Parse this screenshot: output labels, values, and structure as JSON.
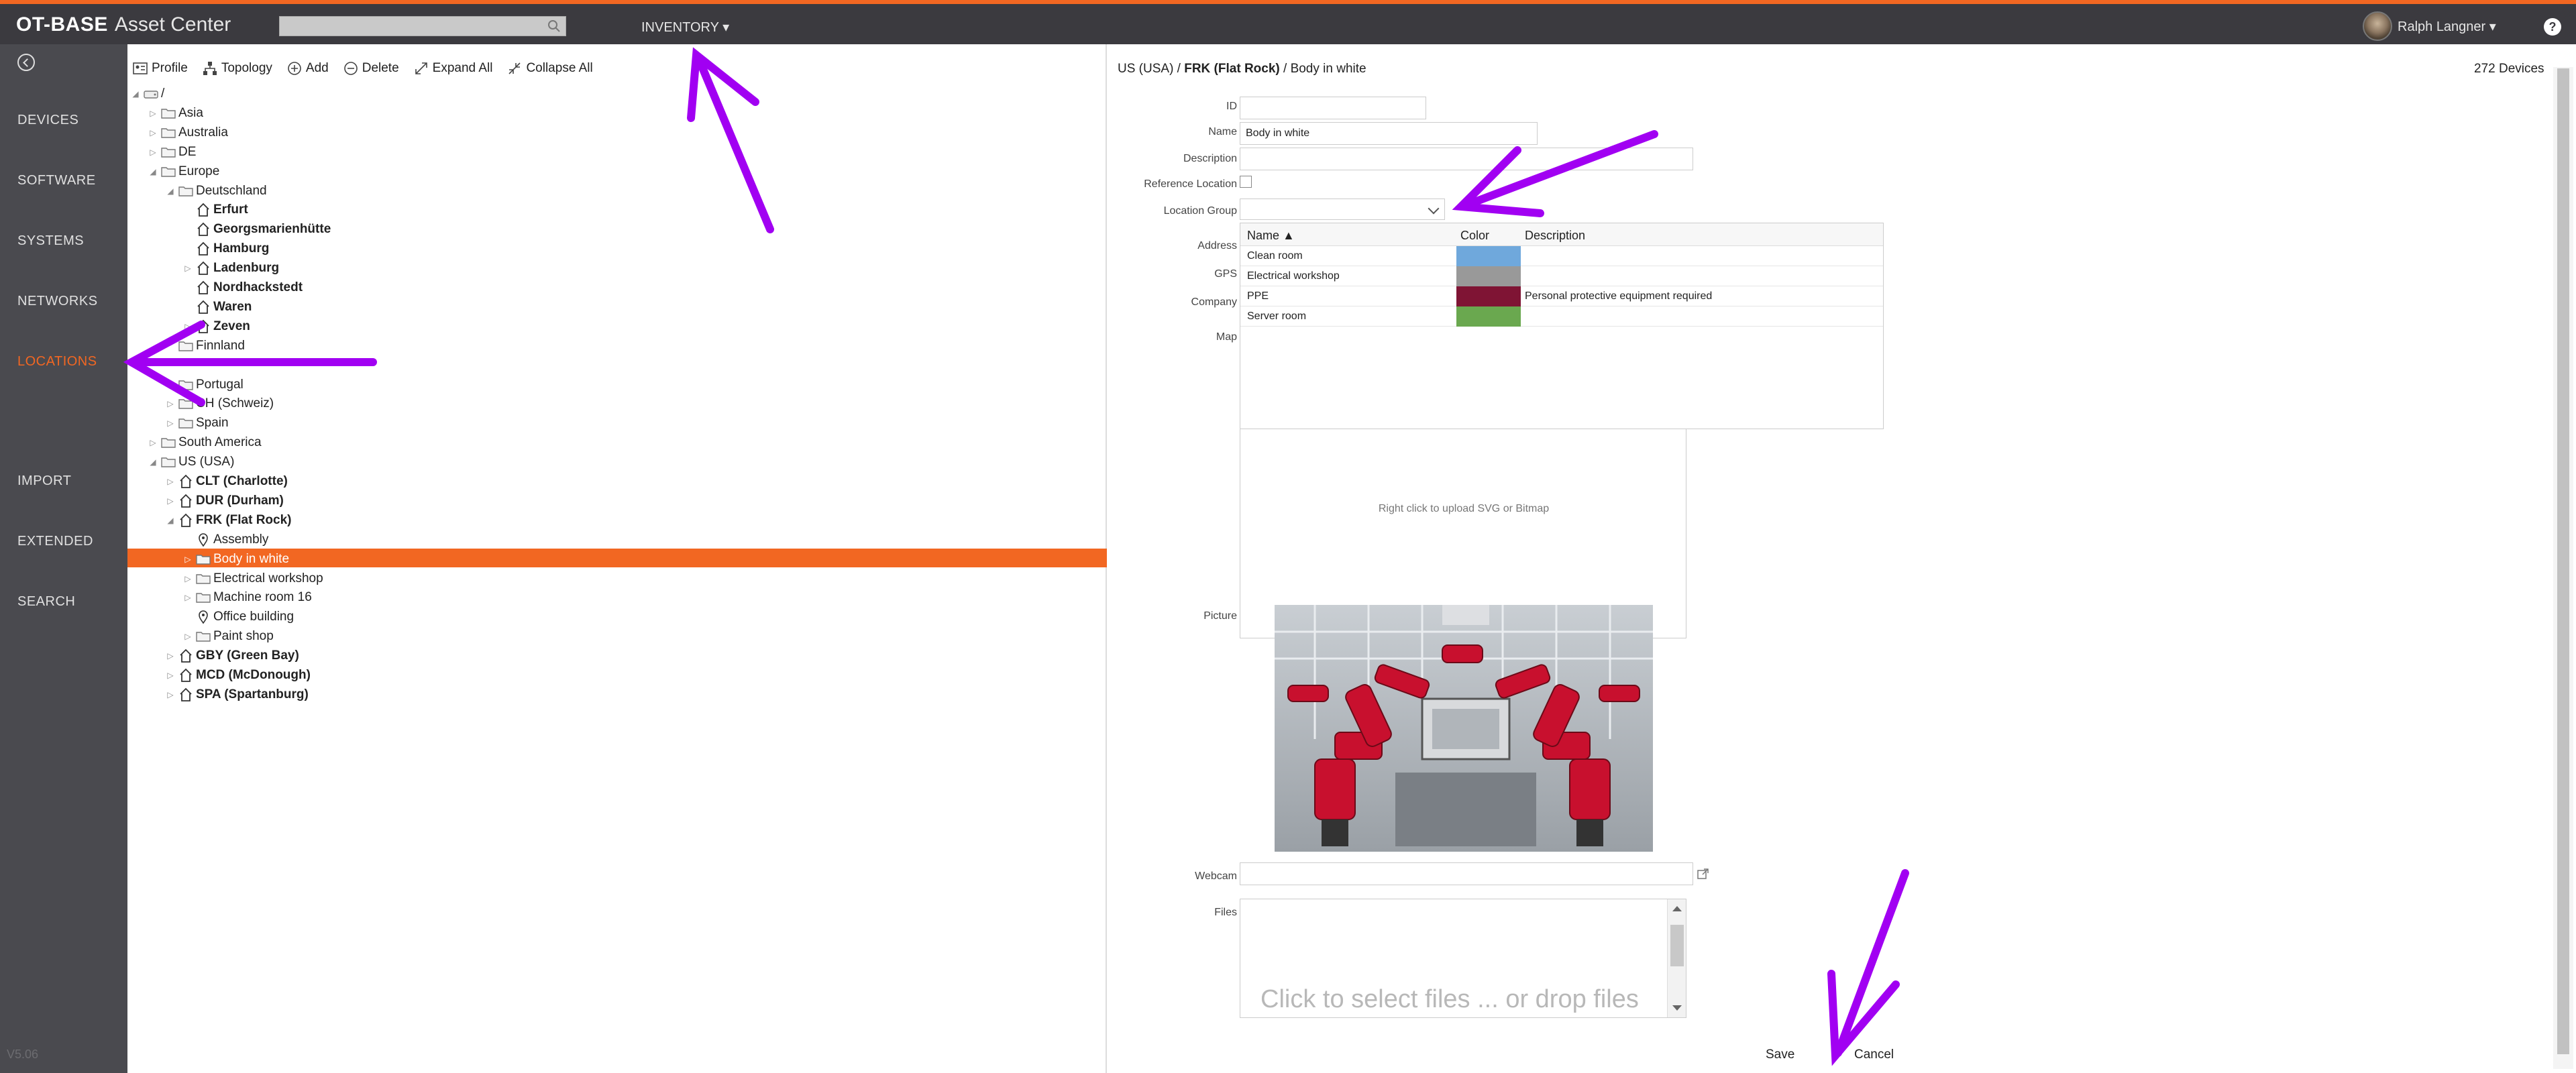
{
  "header": {
    "brand_strong": "OT-BASE",
    "brand_light": "Asset Center",
    "search_placeholder": "",
    "inventory_label": "INVENTORY ▾",
    "user_name": "Ralph Langner ▾",
    "help_glyph": "?"
  },
  "sidebar": {
    "items": [
      {
        "label": "DEVICES",
        "active": false
      },
      {
        "label": "SOFTWARE",
        "active": false
      },
      {
        "label": "SYSTEMS",
        "active": false
      },
      {
        "label": "NETWORKS",
        "active": false
      },
      {
        "label": "LOCATIONS",
        "active": true
      },
      {
        "label": "IMPORT",
        "active": false
      },
      {
        "label": "EXTENDED",
        "active": false
      },
      {
        "label": "SEARCH",
        "active": false
      }
    ],
    "version": "V5.06"
  },
  "toolbar": {
    "profile": "Profile",
    "topology": "Topology",
    "add": "Add",
    "delete": "Delete",
    "expand_all": "Expand All",
    "collapse_all": "Collapse All"
  },
  "tree": [
    {
      "label": "/",
      "kind": "root",
      "level": 0,
      "state": "open"
    },
    {
      "label": "Asia",
      "kind": "folder",
      "level": 1,
      "state": "closed"
    },
    {
      "label": "Australia",
      "kind": "folder",
      "level": 1,
      "state": "closed"
    },
    {
      "label": "DE",
      "kind": "folder",
      "level": 1,
      "state": "closed"
    },
    {
      "label": "Europe",
      "kind": "folder",
      "level": 1,
      "state": "open"
    },
    {
      "label": "Deutschland",
      "kind": "folder",
      "level": 2,
      "state": "open"
    },
    {
      "label": "Erfurt",
      "kind": "site",
      "level": 3,
      "state": "none",
      "bold": true
    },
    {
      "label": "Georgsmarienhütte",
      "kind": "site",
      "level": 3,
      "state": "none",
      "bold": true
    },
    {
      "label": "Hamburg",
      "kind": "site",
      "level": 3,
      "state": "none",
      "bold": true
    },
    {
      "label": "Ladenburg",
      "kind": "site",
      "level": 3,
      "state": "closed",
      "bold": true
    },
    {
      "label": "Nordhackstedt",
      "kind": "site",
      "level": 3,
      "state": "none",
      "bold": true
    },
    {
      "label": "Waren",
      "kind": "site",
      "level": 3,
      "state": "none",
      "bold": true
    },
    {
      "label": "Zeven",
      "kind": "site",
      "level": 3,
      "state": "closed",
      "bold": true
    },
    {
      "label": "Finnland",
      "kind": "folder",
      "level": 2,
      "state": "none"
    },
    {
      "label": "",
      "kind": "blank",
      "level": 2,
      "state": "none"
    },
    {
      "label": "Portugal",
      "kind": "folder",
      "level": 2,
      "state": "none"
    },
    {
      "label": "CH (Schweiz)",
      "kind": "folder",
      "level": 2,
      "state": "closed"
    },
    {
      "label": "Spain",
      "kind": "folder",
      "level": 2,
      "state": "closed"
    },
    {
      "label": "South America",
      "kind": "folder",
      "level": 1,
      "state": "closed"
    },
    {
      "label": "US (USA)",
      "kind": "folder",
      "level": 1,
      "state": "open"
    },
    {
      "label": "CLT (Charlotte)",
      "kind": "site",
      "level": 2,
      "state": "closed",
      "bold": true
    },
    {
      "label": "DUR (Durham)",
      "kind": "site",
      "level": 2,
      "state": "closed",
      "bold": true
    },
    {
      "label": "FRK (Flat Rock)",
      "kind": "site",
      "level": 2,
      "state": "open",
      "bold": true
    },
    {
      "label": "Assembly",
      "kind": "pin",
      "level": 3,
      "state": "none"
    },
    {
      "label": "Body in white",
      "kind": "folder",
      "level": 3,
      "state": "closed",
      "selected": true
    },
    {
      "label": "Electrical workshop",
      "kind": "folder",
      "level": 3,
      "state": "closed"
    },
    {
      "label": "Machine room 16",
      "kind": "folder",
      "level": 3,
      "state": "closed"
    },
    {
      "label": "Office building",
      "kind": "pin",
      "level": 3,
      "state": "none"
    },
    {
      "label": "Paint shop",
      "kind": "folder",
      "level": 3,
      "state": "closed"
    },
    {
      "label": "GBY (Green Bay)",
      "kind": "site",
      "level": 2,
      "state": "closed",
      "bold": true
    },
    {
      "label": "MCD (McDonough)",
      "kind": "site",
      "level": 2,
      "state": "closed",
      "bold": true
    },
    {
      "label": "SPA (Spartanburg)",
      "kind": "site",
      "level": 2,
      "state": "closed",
      "bold": true
    }
  ],
  "detail": {
    "breadcrumb": {
      "part1": "US (USA) / ",
      "part2": "FRK (Flat Rock)",
      "part3": " / Body in white"
    },
    "device_count": "272 Devices",
    "labels": {
      "id": "ID",
      "name": "Name",
      "description": "Description",
      "reference_location": "Reference Location",
      "location_group": "Location Group",
      "address": "Address",
      "gps": "GPS",
      "company": "Company",
      "map": "Map",
      "picture": "Picture",
      "webcam": "Webcam",
      "files": "Files"
    },
    "values": {
      "id": "",
      "name": "Body in white",
      "description": "",
      "webcam": ""
    },
    "dropdown": {
      "headers": {
        "name": "Name ▲",
        "color": "Color",
        "description": "Description"
      },
      "rows": [
        {
          "name": "Clean room",
          "color": "#6fa8dc",
          "description": ""
        },
        {
          "name": "Electrical workshop",
          "color": "#999999",
          "description": ""
        },
        {
          "name": "PPE",
          "color": "#7f1434",
          "description": "Personal protective equipment required"
        },
        {
          "name": "Server room",
          "color": "#6aa84f",
          "description": ""
        }
      ]
    },
    "map_hint": "Right click to upload SVG or Bitmap",
    "files_placeholder": "Click to select files ... or drop files",
    "save_label": "Save",
    "cancel_label": "Cancel"
  },
  "colors": {
    "accent": "#f26722",
    "annotation": "#a100f2",
    "topbar": "#3b3a3f",
    "sidebar": "#4a4a4f"
  }
}
